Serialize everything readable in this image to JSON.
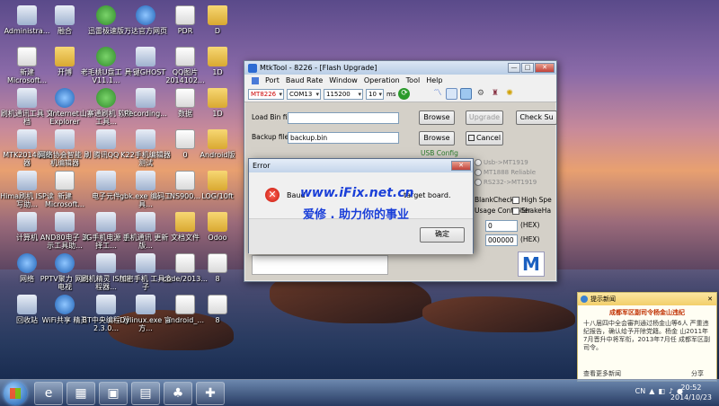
{
  "desktop_icons": [
    {
      "label": "Administra...",
      "kind": "app"
    },
    {
      "label": "新建 Microsoft...",
      "kind": "doc"
    },
    {
      "label": "刷机通讯工具 文档",
      "kind": "app"
    },
    {
      "label": "MTK2014编辑器",
      "kind": "app"
    },
    {
      "label": "Hima刷机 ISP读写助...",
      "kind": "app"
    },
    {
      "label": "计算机",
      "kind": "app"
    },
    {
      "label": "网络",
      "kind": "blue"
    },
    {
      "label": "回收站",
      "kind": "app"
    },
    {
      "label": "融合",
      "kind": "app"
    },
    {
      "label": "开博",
      "kind": "folder"
    },
    {
      "label": "Internet Explorer",
      "kind": "blue"
    },
    {
      "label": "网络协会智能 刷机编辑器",
      "kind": "app"
    },
    {
      "label": "新建 Microsoft...",
      "kind": "doc"
    },
    {
      "label": "AND80电子 演示工具助...",
      "kind": "app"
    },
    {
      "label": "PPTV聚力 网络电视",
      "kind": "blue"
    },
    {
      "label": "WiFi共享 精灵",
      "kind": "blue"
    },
    {
      "label": "迅雷极速版",
      "kind": "green"
    },
    {
      "label": "老毛桃U盘工 具V11.1...",
      "kind": "green"
    },
    {
      "label": "山寨通刷机 软件工具...",
      "kind": "green"
    },
    {
      "label": "腾讯QQ",
      "kind": "app"
    },
    {
      "label": "电子元件",
      "kind": "app"
    },
    {
      "label": "3G手机电源 选择工...",
      "kind": "app"
    },
    {
      "label": "刷机精灵 ISP编程器...",
      "kind": "app"
    },
    {
      "label": "BT中央编程 器2.3.0...",
      "kind": "app"
    },
    {
      "label": "万达官方网页",
      "kind": "blue"
    },
    {
      "label": "一键GHOST",
      "kind": "app"
    },
    {
      "label": "Recording...",
      "kind": "app"
    },
    {
      "label": "K22手机编辑器 测试",
      "kind": "app"
    },
    {
      "label": "gbk.exe 编码工具...",
      "kind": "app"
    },
    {
      "label": "手机通讯 更新版...",
      "kind": "app"
    },
    {
      "label": "加密手机 工具盒子",
      "kind": "app"
    },
    {
      "label": "Dylinux.exe 官方...",
      "kind": "app"
    },
    {
      "label": "PDR",
      "kind": "doc"
    },
    {
      "label": "QQ图片 2014102...",
      "kind": "doc"
    },
    {
      "label": "数据",
      "kind": "doc"
    },
    {
      "label": "0",
      "kind": "doc"
    },
    {
      "label": "NS900...",
      "kind": "doc"
    },
    {
      "label": "文档文件",
      "kind": "folder"
    },
    {
      "label": "code/2013...",
      "kind": "doc"
    },
    {
      "label": "android_...",
      "kind": "doc"
    },
    {
      "label": "D",
      "kind": "folder"
    },
    {
      "label": "1D",
      "kind": "folder"
    },
    {
      "label": "1D",
      "kind": "folder"
    },
    {
      "label": "Android版",
      "kind": "folder"
    },
    {
      "label": "LOG/10ft",
      "kind": "folder"
    },
    {
      "label": "Odoo",
      "kind": "folder"
    },
    {
      "label": "8",
      "kind": "doc"
    },
    {
      "label": "8",
      "kind": "doc"
    }
  ],
  "mtktool": {
    "title": "MtkTool - 8226 - [Flash Upgrade]",
    "title_buttons": [
      "—",
      "□",
      "✕"
    ],
    "menu": [
      "Port",
      "Baud Rate",
      "Window",
      "Operation",
      "Tool",
      "Help"
    ],
    "toolbar": {
      "chip": "MT8226",
      "port": "COM13",
      "baud": "115200",
      "timeout": "10",
      "timeout_unit": "ms"
    },
    "load_bin_label": "Load Bin file:",
    "load_bin_value": "",
    "backup_label": "Backup file:",
    "backup_value": "backup.bin",
    "browse1": "Browse",
    "browse2": "Browse",
    "upgrade": "Upgrade",
    "check_su": "Check Su",
    "cancel": "Cancel",
    "usb_config": "USB Config",
    "radios": [
      "Usb->MT1919",
      "MT1888 Reliable",
      "RS232->MT1919"
    ],
    "blank_check": "BlankCheck",
    "high_spe": "High Spe",
    "usage_controller": "Usage Controller",
    "shakeha": "ShakeHa",
    "hex_label1": "(HEX)",
    "hex_label2": "(HEX)",
    "hex_value1": "0",
    "hex_value2": "000000",
    "logo_letter": "M"
  },
  "error_dialog": {
    "title": "Error",
    "close": "✕",
    "message_left": "Baud",
    "message_right": "target board.",
    "ok": "确定"
  },
  "watermark": {
    "line1": "www.iFix.net.cn",
    "line2": "爱修 . 助力你的事业"
  },
  "notification": {
    "header": "提示新闻",
    "title": "成都军区副司令杨金山违纪",
    "body": "十八届四中全会審判通过杨金山等6人 严重违纪报告，确认给予开除党籍。杨金 山2011年7月晋升中将军衔，2013年7月任 成都军区副司令。",
    "more": "查看更多新闻",
    "share": "分享"
  },
  "taskbar": {
    "tray_lang": "CN",
    "time": "20:52",
    "date": "2014/10/23"
  }
}
